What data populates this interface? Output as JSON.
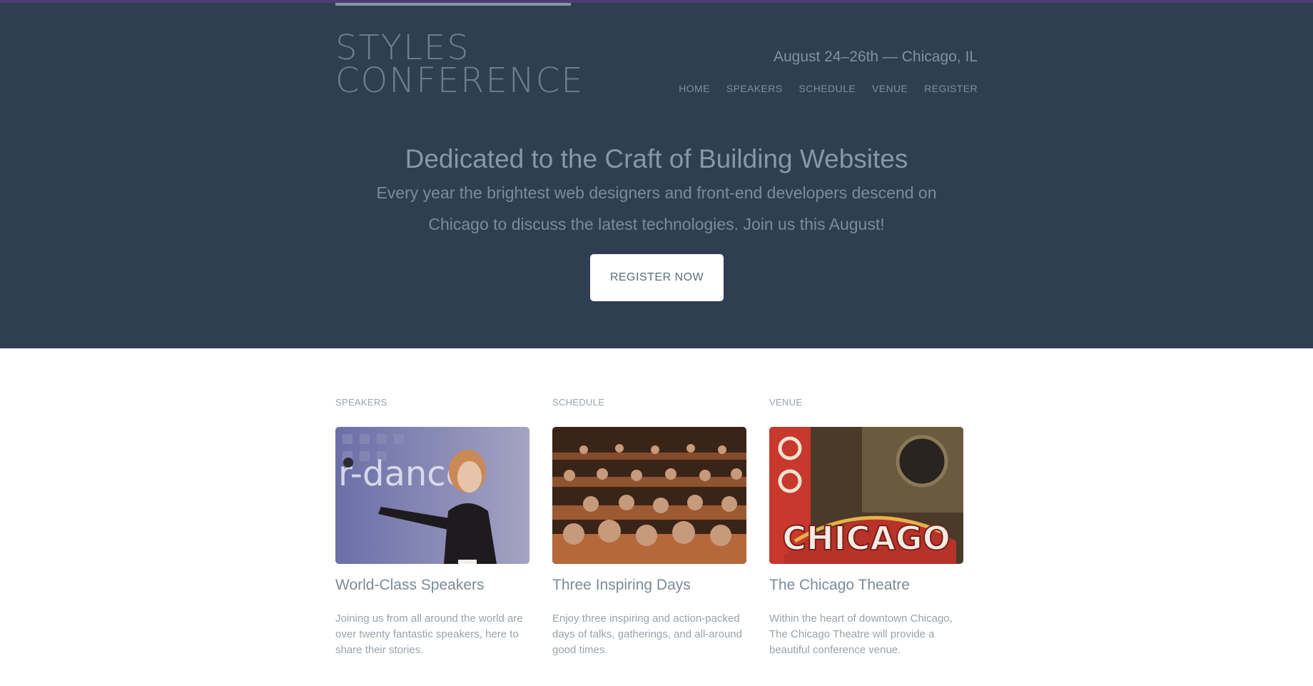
{
  "header": {
    "logo_line1": "STYLES",
    "logo_line2": "CONFERENCE",
    "tagline": "August 24–26th — Chicago, IL",
    "nav": [
      {
        "label": "HOME"
      },
      {
        "label": "SPEAKERS"
      },
      {
        "label": "SCHEDULE"
      },
      {
        "label": "VENUE"
      },
      {
        "label": "REGISTER"
      }
    ]
  },
  "hero": {
    "heading": "Dedicated to the Craft of Building Websites",
    "text": "Every year the brightest web designers and front-end developers descend on Chicago to discuss the latest technologies. Join us this August!",
    "button_label": "REGISTER NOW"
  },
  "features": [
    {
      "label": "SPEAKERS",
      "title": "World-Class Speakers",
      "text": "Joining us from all around the world are over twenty fantastic speakers, here to share their stories."
    },
    {
      "label": "SCHEDULE",
      "title": "Three Inspiring Days",
      "text": "Enjoy three inspiring and action-packed days of talks, gatherings, and all-around good times."
    },
    {
      "label": "VENUE",
      "title": "The Chicago Theatre",
      "text": "Within the heart of downtown Chicago, The Chicago Theatre will provide a beautiful conference venue.",
      "sign_text": "CHICAGO"
    }
  ],
  "colors": {
    "hero_background": "#2f3e50",
    "top_strip": "#4b3f72",
    "nav_text": "#7f8fa0",
    "button_background": "#ffffff"
  }
}
